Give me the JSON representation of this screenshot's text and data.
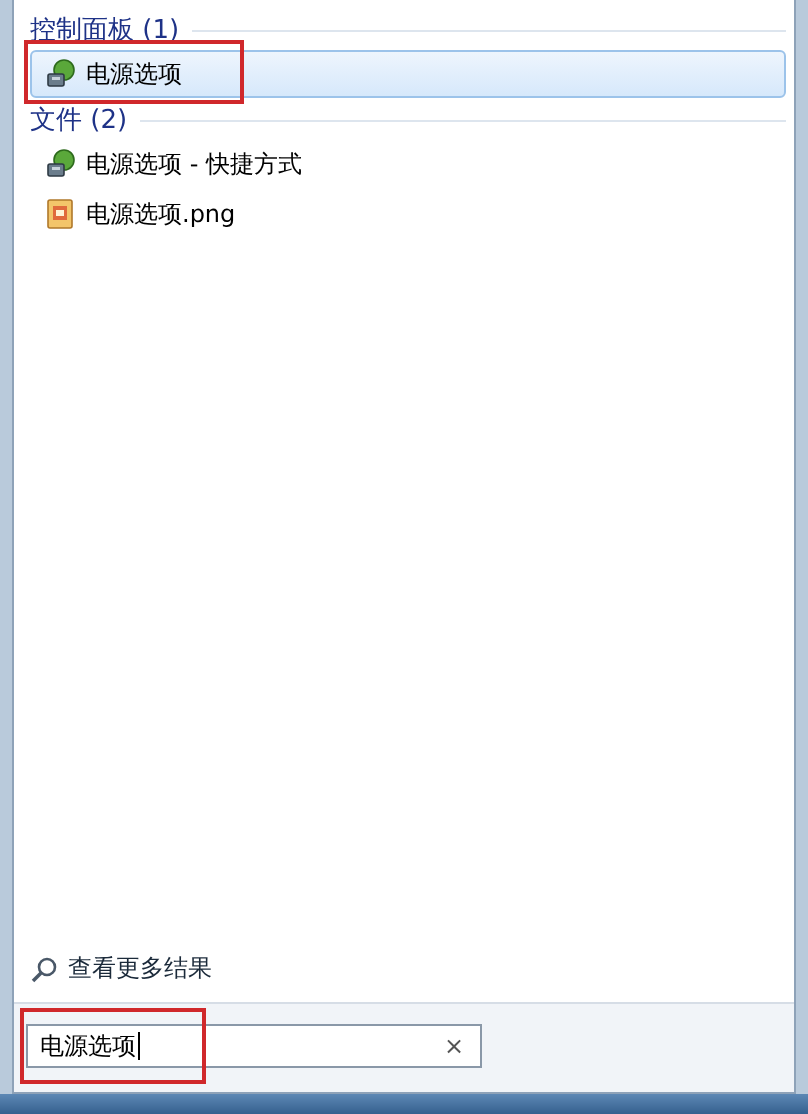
{
  "groups": [
    {
      "title": "控制面板 (1)",
      "items": [
        {
          "label": "电源选项",
          "kind": "power",
          "selected": true,
          "marked": true
        }
      ]
    },
    {
      "title": "文件 (2)",
      "items": [
        {
          "label": "电源选项 - 快捷方式",
          "kind": "power",
          "selected": false,
          "marked": false
        },
        {
          "label": "电源选项.png",
          "kind": "image",
          "selected": false,
          "marked": false
        }
      ]
    }
  ],
  "more_results": "查看更多结果",
  "search": {
    "value": "电源选项",
    "marked": true,
    "clear": "×"
  }
}
